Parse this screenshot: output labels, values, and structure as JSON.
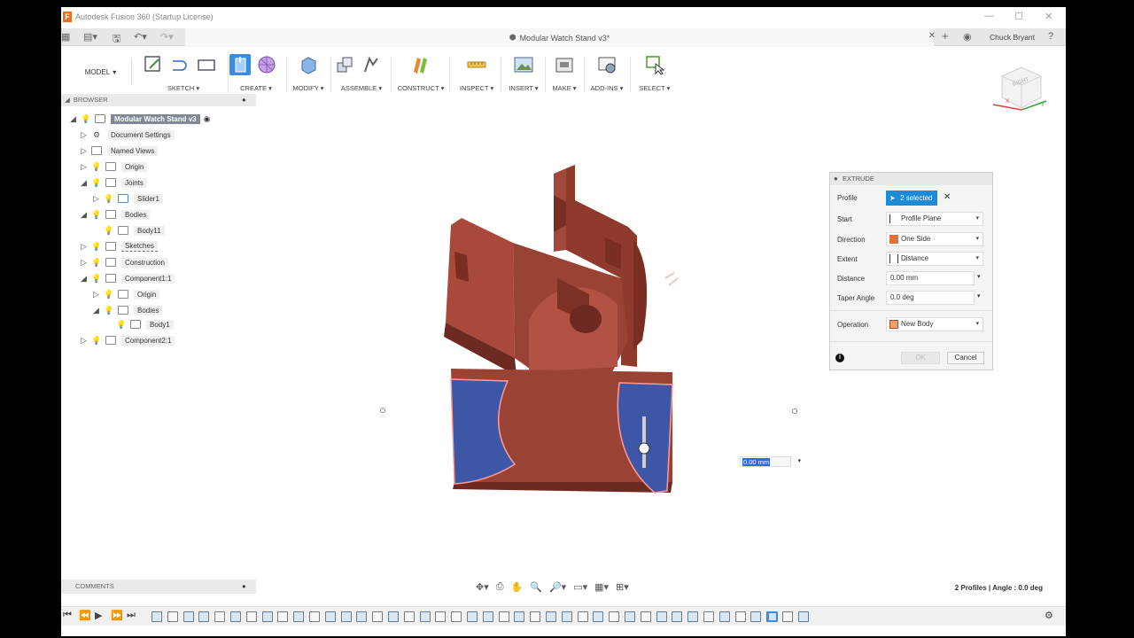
{
  "window": {
    "title": "Autodesk Fusion 360 (Startup License)",
    "logo_letter": "F"
  },
  "tab": {
    "title": "Modular Watch Stand v3*"
  },
  "user": {
    "name": "Chuck Bryant"
  },
  "toolbar": {
    "workspace": "MODEL",
    "groups": [
      {
        "label": "SKETCH ▾"
      },
      {
        "label": "CREATE ▾"
      },
      {
        "label": "MODIFY ▾"
      },
      {
        "label": "ASSEMBLE ▾"
      },
      {
        "label": "CONSTRUCT ▾"
      },
      {
        "label": "INSPECT ▾"
      },
      {
        "label": "INSERT ▾"
      },
      {
        "label": "MAKE ▾"
      },
      {
        "label": "ADD-INS ▾"
      },
      {
        "label": "SELECT ▾"
      }
    ]
  },
  "browser": {
    "header": "BROWSER",
    "root": "Modular Watch Stand v3",
    "items": [
      {
        "label": "Document Settings"
      },
      {
        "label": "Named Views"
      },
      {
        "label": "Origin"
      },
      {
        "label": "Joints"
      },
      {
        "label": "Slider1"
      },
      {
        "label": "Bodies"
      },
      {
        "label": "Body11"
      },
      {
        "label": "Sketches"
      },
      {
        "label": "Construction"
      },
      {
        "label": "Component1:1"
      },
      {
        "label": "Origin"
      },
      {
        "label": "Bodies"
      },
      {
        "label": "Body1"
      },
      {
        "label": "Component2:1"
      }
    ]
  },
  "extrude": {
    "title": "EXTRUDE",
    "profile": {
      "label": "Profile",
      "value": "2 selected"
    },
    "start": {
      "label": "Start",
      "value": "Profile Plane"
    },
    "direction": {
      "label": "Direction",
      "value": "One Side"
    },
    "extent": {
      "label": "Extent",
      "value": "Distance"
    },
    "distance": {
      "label": "Distance",
      "value": "0.00 mm"
    },
    "taper": {
      "label": "Taper Angle",
      "value": "0.0 deg"
    },
    "operation": {
      "label": "Operation",
      "value": "New Body"
    },
    "ok": "OK",
    "cancel": "Cancel"
  },
  "viewport": {
    "distance_input": "0.00 mm"
  },
  "comments": {
    "header": "COMMENTS"
  },
  "status": {
    "text": "2 Profiles | Angle : 0.0 deg"
  },
  "viewcube": {
    "face": "RIGHT"
  }
}
